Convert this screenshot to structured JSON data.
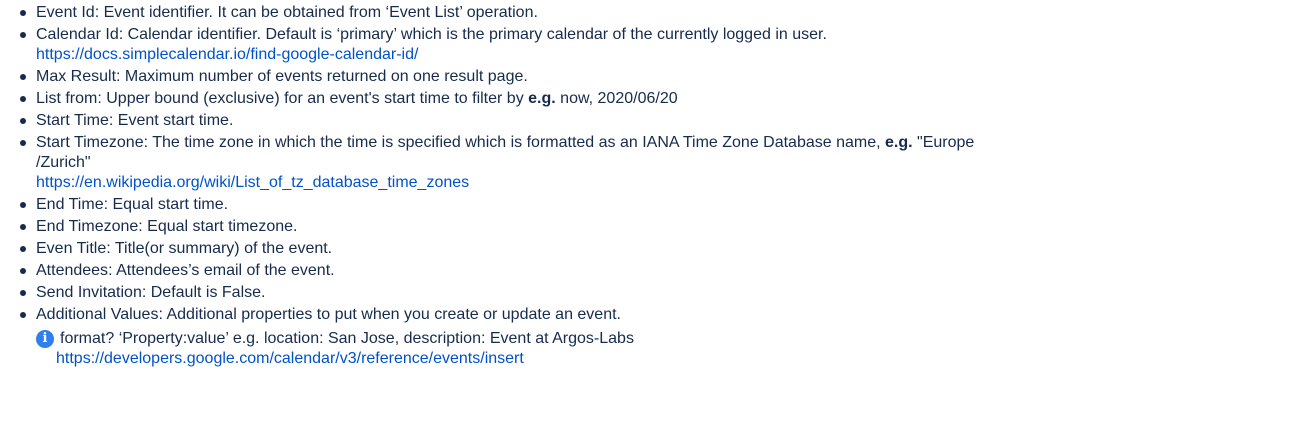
{
  "params": [
    {
      "name": "Event Id",
      "desc": "Event identifier. It can be obtained from ‘Event List’ operation."
    },
    {
      "name": "Calendar Id",
      "desc": "Calendar identifier. Default is ‘primary’ which is the primary calendar of the currently logged in user.",
      "link": "https://docs.simplecalendar.io/find-google-calendar-id/"
    },
    {
      "name": "Max Result",
      "desc": "Maximum number of events returned on one result page."
    },
    {
      "name": "List from",
      "desc_before": "Upper bound (exclusive) for an event's start time to filter by",
      "eg": "e.g.",
      "desc_after": "now, 2020/06/20"
    },
    {
      "name": "Start Time",
      "desc": "Event start time."
    },
    {
      "name": "Start Timezone",
      "desc_before": "The time zone in which the time is specified which is formatted as an IANA Time Zone Database name,",
      "eg": "e.g.",
      "desc_after": "\"Europe",
      "desc_line2": "/Zurich\"",
      "link": "https://en.wikipedia.org/wiki/List_of_tz_database_time_zones"
    },
    {
      "name": "End Time",
      "desc": "Equal start time."
    },
    {
      "name": "End Timezone",
      "desc": "Equal start timezone."
    },
    {
      "name": "Even Title",
      "desc": "Title(or summary) of the event."
    },
    {
      "name": "Attendees",
      "desc": "Attendees’s email of the event."
    },
    {
      "name": "Send Invitation",
      "desc": "Default is False."
    },
    {
      "name": "Additional Values",
      "desc": "Additional properties to put when you create or update an event.",
      "note": {
        "icon": "info-icon",
        "text": "format? ‘Property:value’ e.g. location: San Jose, description: Event at Argos-Labs",
        "link": "https://developers.google.com/calendar/v3/reference/events/insert"
      }
    }
  ],
  "colors": {
    "text": "#172b4d",
    "link": "#0052cc",
    "info_icon": "#2f80ed"
  },
  "separator": ": "
}
